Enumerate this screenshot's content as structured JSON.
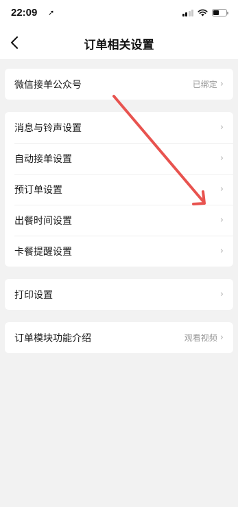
{
  "status_bar": {
    "time": "22:09",
    "location_glyph": "➚",
    "battery_level": 0.45
  },
  "nav": {
    "title": "订单相关设置",
    "back_glyph": "<"
  },
  "groups": [
    {
      "rows": [
        {
          "label": "微信接单公众号",
          "value": "已绑定",
          "chevron": "›"
        }
      ]
    },
    {
      "rows": [
        {
          "label": "消息与铃声设置",
          "chevron": "›"
        },
        {
          "label": "自动接单设置",
          "chevron": "›"
        },
        {
          "label": "预订单设置",
          "chevron": "›"
        },
        {
          "label": "出餐时间设置",
          "chevron": "›"
        },
        {
          "label": "卡餐提醒设置",
          "chevron": "›"
        }
      ]
    },
    {
      "rows": [
        {
          "label": "打印设置",
          "chevron": "›"
        }
      ]
    },
    {
      "rows": [
        {
          "label": "订单模块功能介绍",
          "value": "观看视频",
          "chevron": "›"
        }
      ]
    }
  ],
  "annotation": {
    "arrow_color": "#e8534f"
  }
}
